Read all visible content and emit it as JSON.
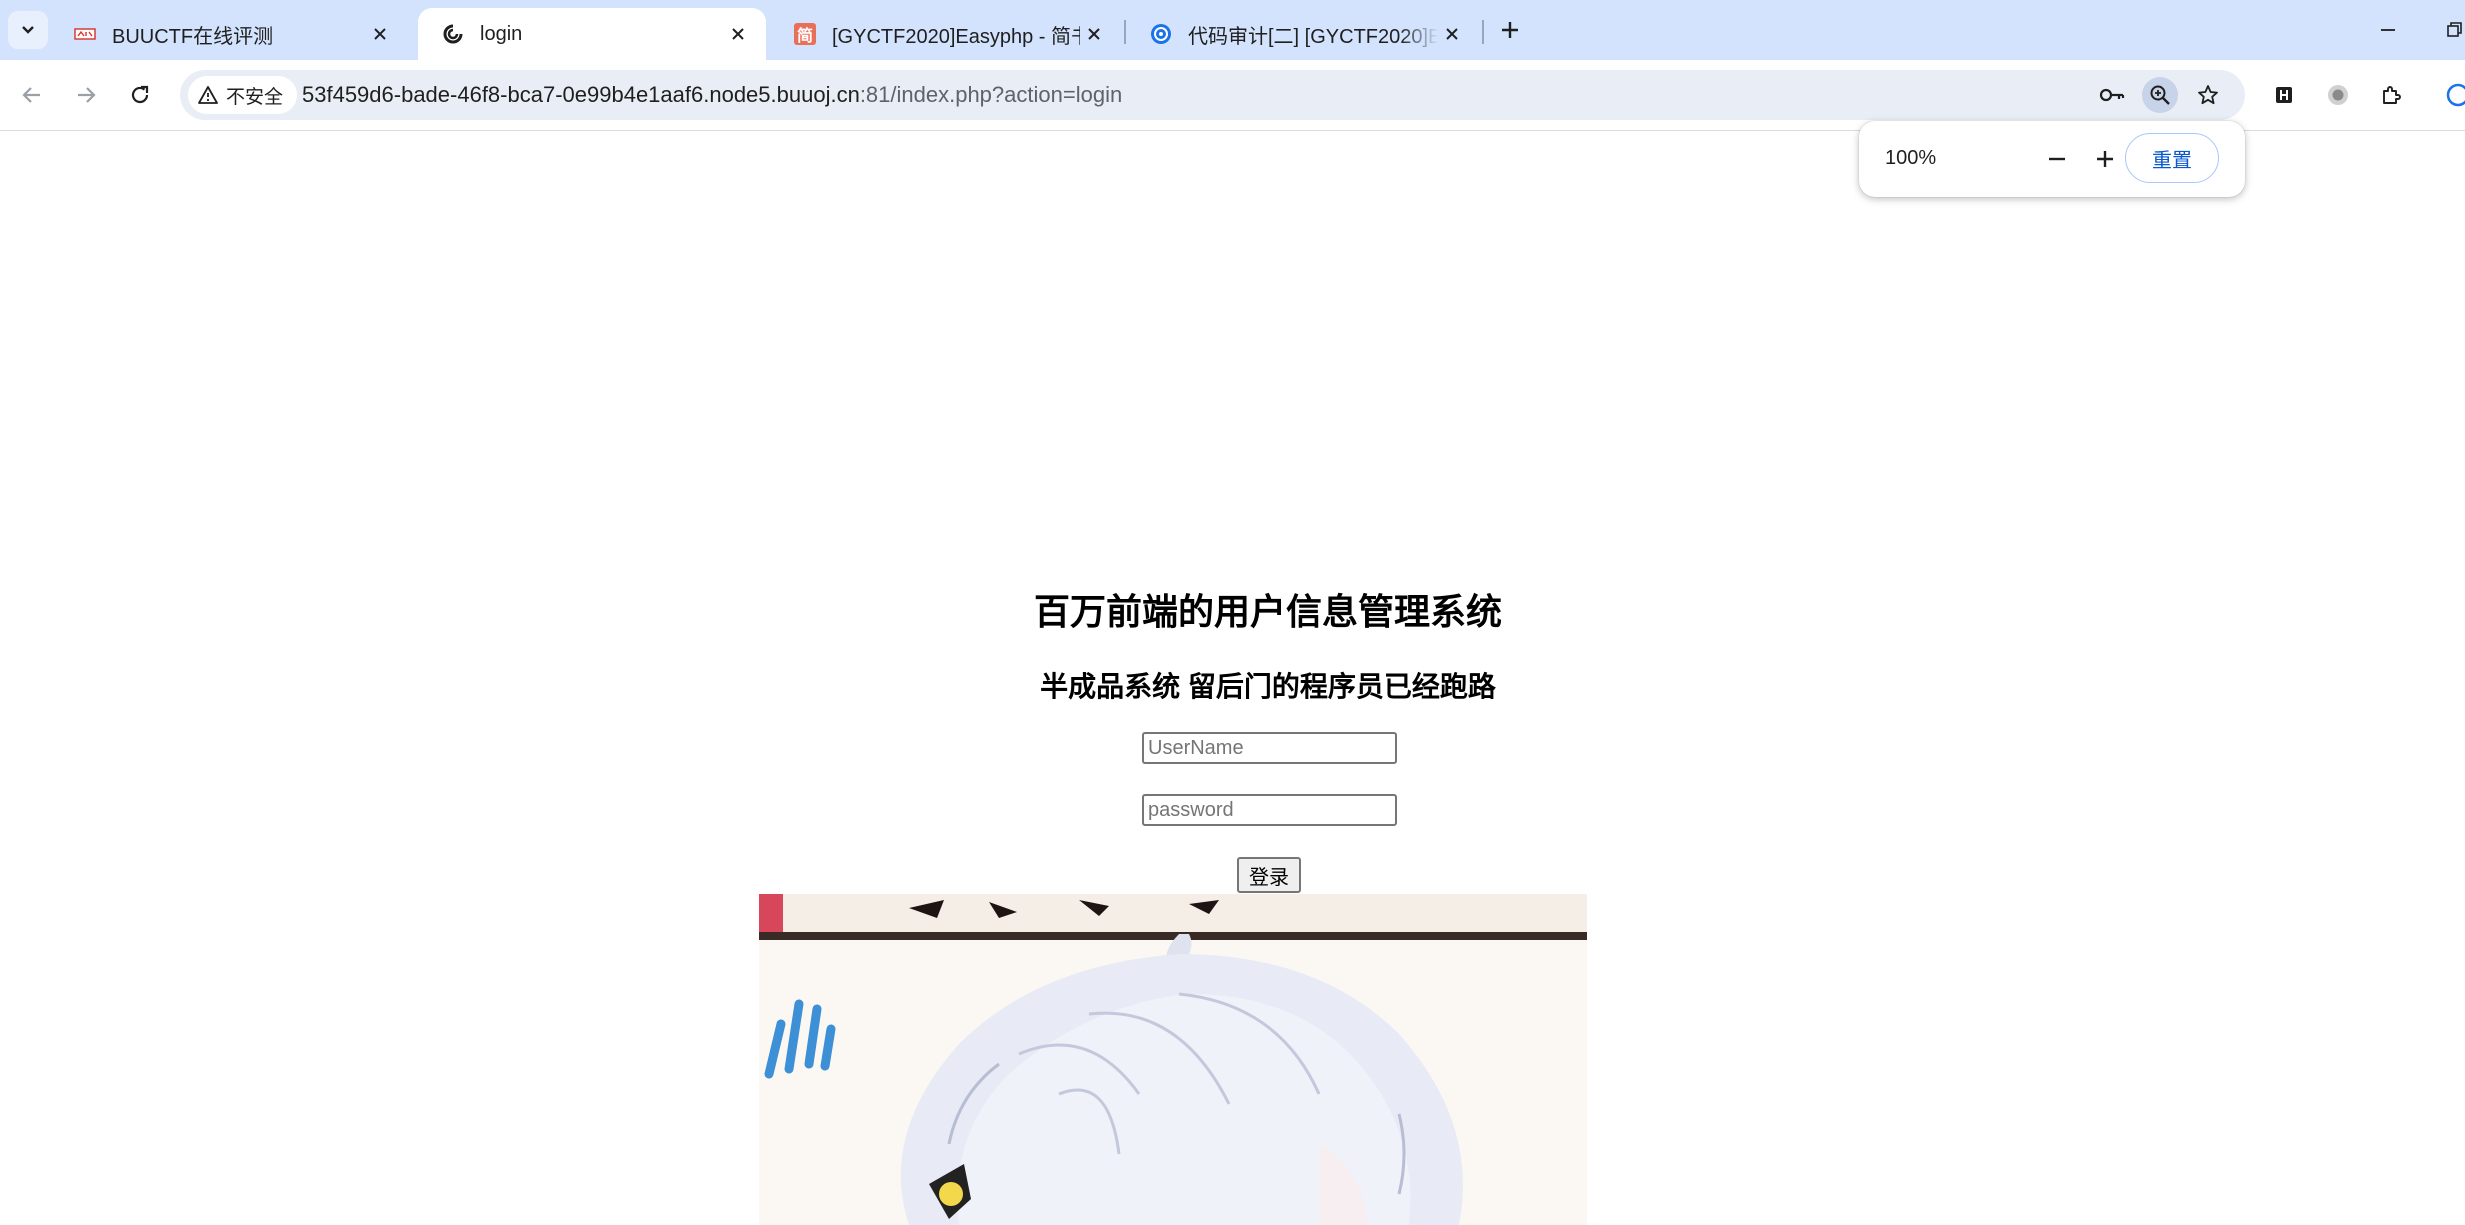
{
  "browser": {
    "tabs": [
      {
        "title": "BUUCTF在线评测",
        "active": false
      },
      {
        "title": "login",
        "active": true
      },
      {
        "title": "[GYCTF2020]Easyphp - 简书",
        "active": false
      },
      {
        "title": "代码审计[二] [GYCTF2020]Easy",
        "active": false
      }
    ],
    "favicons": {
      "tab3": "简"
    },
    "security_label": "不安全",
    "url_host": "53f459d6-bade-46f8-bca7-0e99b4e1aaf6.node5.buuoj.cn",
    "url_rest": ":81/index.php?action=login",
    "zoom": {
      "level": "100%",
      "reset_label": "重置"
    }
  },
  "page": {
    "title": "百万前端的用户信息管理系统",
    "subtitle": "半成品系统 留后门的程序员已经跑路",
    "username_placeholder": "UserName",
    "password_placeholder": "password",
    "login_label": "登录"
  },
  "colors": {
    "tabstrip": "#d3e3fd",
    "omnibox": "#e9eef6",
    "zoom_accent": "#0b57d0"
  }
}
